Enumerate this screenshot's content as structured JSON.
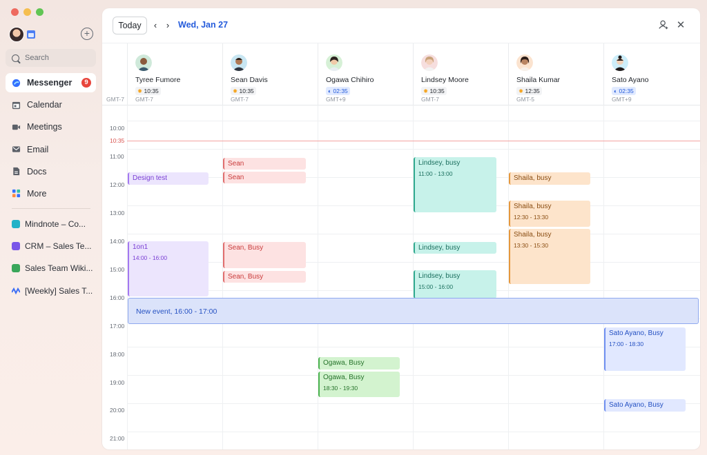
{
  "window": {
    "dots": [
      "#ee6a5f",
      "#f5be4f",
      "#61c554"
    ]
  },
  "sidebar": {
    "search_placeholder": "Search",
    "nav": [
      {
        "label": "Messenger",
        "icon": "messenger-icon",
        "badge": "9",
        "active": true
      },
      {
        "label": "Calendar",
        "icon": "calendar-icon"
      },
      {
        "label": "Meetings",
        "icon": "video-icon"
      },
      {
        "label": "Email",
        "icon": "mail-icon"
      },
      {
        "label": "Docs",
        "icon": "doc-icon"
      },
      {
        "label": "More",
        "icon": "grid-icon"
      }
    ],
    "docs": [
      {
        "label": "Mindnote – Co...",
        "color": "#23b2c7"
      },
      {
        "label": "CRM – Sales Te...",
        "color": "#7a56e8"
      },
      {
        "label": "Sales Team Wiki...",
        "color": "#3aa65a"
      },
      {
        "label": "[Weekly] Sales T...",
        "color": "#3d6ff5"
      }
    ]
  },
  "toolbar": {
    "today": "Today",
    "prev": "‹",
    "next": "›",
    "date": "Wed, Jan 27"
  },
  "header": {
    "tz": "GMT-7",
    "people": [
      {
        "name": "Tyree Fumore",
        "time": "10:35",
        "period": "day",
        "gmt": "GMT-7"
      },
      {
        "name": "Sean Davis",
        "time": "10:35",
        "period": "day",
        "gmt": "GMT-7"
      },
      {
        "name": "Ogawa Chihiro",
        "time": "02:35",
        "period": "night",
        "gmt": "GMT+9"
      },
      {
        "name": "Lindsey Moore",
        "time": "10:35",
        "period": "day",
        "gmt": "GMT-7"
      },
      {
        "name": "Shaila Kumar",
        "time": "12:35",
        "period": "day",
        "gmt": "GMT-5"
      },
      {
        "name": "Sato Ayano",
        "time": "02:35",
        "period": "night",
        "gmt": "GMT+9"
      }
    ]
  },
  "grid": {
    "hours": [
      "10:00",
      "11:00",
      "12:00",
      "13:00",
      "14:00",
      "15:00",
      "16:00",
      "17:00",
      "18:00",
      "19:00",
      "20:00",
      "21:00"
    ],
    "now_label": "10:35"
  },
  "events": [
    {
      "title": "Design test",
      "time": "",
      "style": "purple"
    },
    {
      "title": "1on1",
      "time": "14:00 - 16:00",
      "style": "purple"
    },
    {
      "title": "Sean",
      "time": "",
      "style": "red"
    },
    {
      "title": "Sean",
      "time": "",
      "style": "red"
    },
    {
      "title": "Sean,  Busy",
      "time": "",
      "style": "red"
    },
    {
      "title": "Sean, Busy",
      "time": "",
      "style": "red"
    },
    {
      "title": "Lindsey, busy",
      "time": "11:00 - 13:00",
      "style": "teal"
    },
    {
      "title": "Lindsey, busy",
      "time": "",
      "style": "teal"
    },
    {
      "title": "Lindsey, busy",
      "time": "15:00 - 16:00",
      "style": "teal"
    },
    {
      "title": "Shaila, busy",
      "time": "",
      "style": "orange"
    },
    {
      "title": "Shaila, busy",
      "time": "12:30 - 13:30",
      "style": "orange"
    },
    {
      "title": "Shaila, busy",
      "time": "13:30 - 15:30",
      "style": "orange"
    },
    {
      "title": "Ogawa, Busy",
      "time": "",
      "style": "green"
    },
    {
      "title": "Ogawa, Busy",
      "time": "18:30 - 19:30",
      "style": "green"
    },
    {
      "title": "Sato Ayano, Busy",
      "time": "17:00 - 18:30",
      "style": "blue"
    },
    {
      "title": "Sato Ayano, Busy",
      "time": "",
      "style": "blue"
    }
  ],
  "new_event": {
    "label": "New event, 16:00 - 17:00"
  }
}
